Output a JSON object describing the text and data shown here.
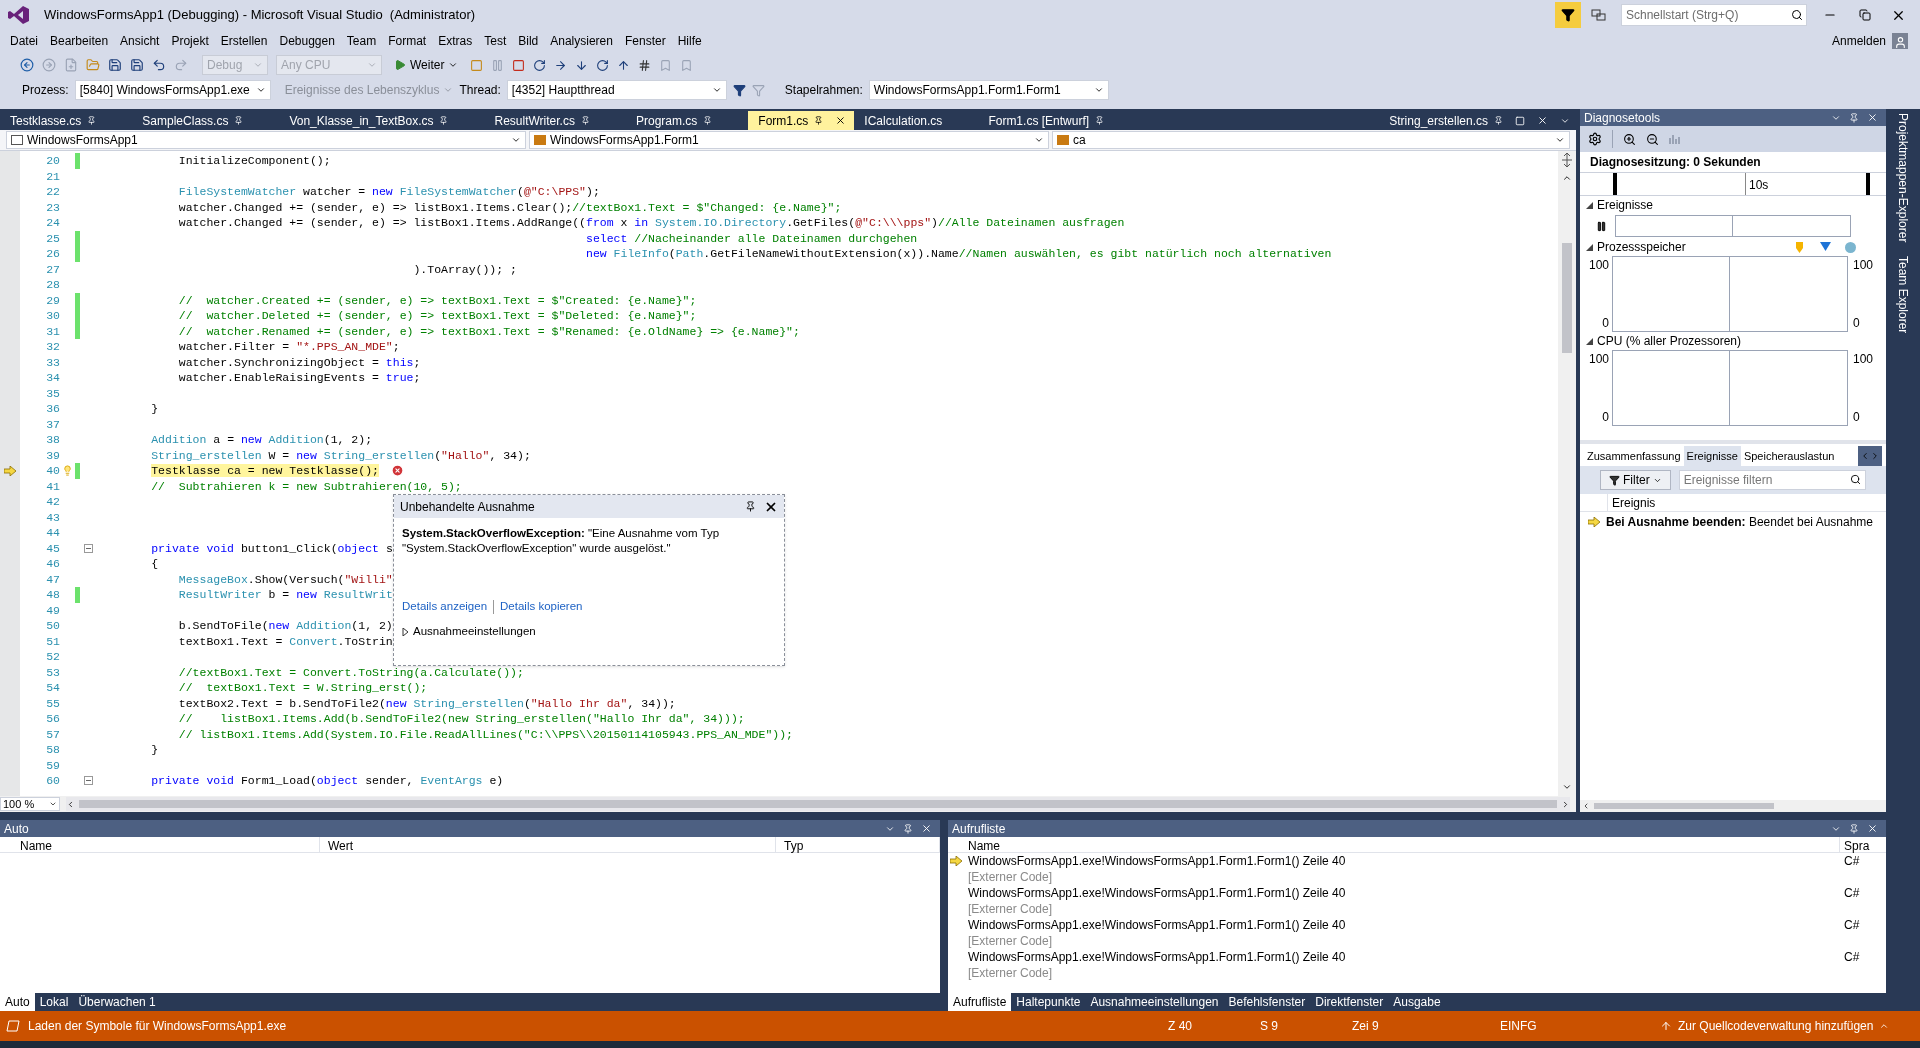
{
  "window": {
    "title": "WindowsFormsApp1 (Debugging) - Microsoft Visual Studio  (Administrator)",
    "quick_launch": {
      "placeholder": "Schnellstart (Strg+Q)"
    }
  },
  "menu": {
    "items": [
      "Datei",
      "Bearbeiten",
      "Ansicht",
      "Projekt",
      "Erstellen",
      "Debuggen",
      "Team",
      "Format",
      "Extras",
      "Test",
      "Bild",
      "Analysieren",
      "Fenster",
      "Hilfe"
    ],
    "account": "Anmelden"
  },
  "toolbar": {
    "configuration": {
      "value": "Debug",
      "disabled": true
    },
    "platform": {
      "value": "Any CPU",
      "disabled": true
    },
    "continue": "Weiter"
  },
  "debug_location": {
    "process_label": "Prozess:",
    "process": "[5840] WindowsFormsApp1.exe",
    "lifecycle_events": {
      "label": "Ereignisse des Lebenszyklus",
      "disabled": true
    },
    "thread_label": "Thread:",
    "thread": "[4352] Hauptthread",
    "stack_frame_label": "Stapelrahmen:",
    "stack_frame": "WindowsFormsApp1.Form1.Form1"
  },
  "editor": {
    "tabs": [
      {
        "label": "Testklasse.cs",
        "selected": false,
        "pinned": true
      },
      {
        "label": "SampleClass.cs",
        "selected": false,
        "pinned": true
      },
      {
        "label": "Von_Klasse_in_TextBox.cs",
        "selected": false,
        "pinned": true
      },
      {
        "label": "ResultWriter.cs",
        "selected": false,
        "pinned": true
      },
      {
        "label": "Program.cs",
        "selected": false,
        "pinned": true
      },
      {
        "label": "Form1.cs",
        "selected": true,
        "pinned": true
      },
      {
        "label": "ICalculation.cs",
        "selected": false,
        "pinned": false
      },
      {
        "label": "Form1.cs [Entwurf]",
        "selected": false,
        "pinned": true
      }
    ],
    "right_tab": {
      "label": "String_erstellen.cs",
      "pinned": true
    },
    "navigation": [
      "WindowsFormsApp1",
      "WindowsFormsApp1.Form1",
      "ca"
    ],
    "lines": [
      {
        "number": "20",
        "changed": true,
        "current": false,
        "foldable": false,
        "code": [
          {
            "kind": "plain",
            "text": "            InitializeComponent();"
          }
        ]
      },
      {
        "number": "21",
        "changed": false,
        "current": false,
        "foldable": false
      },
      {
        "number": "22",
        "changed": false,
        "current": false,
        "foldable": false,
        "code": [
          {
            "kind": "type",
            "text": "            FileSystemWatcher"
          },
          {
            "kind": "plain",
            "text": " watcher = "
          },
          {
            "kind": "kw",
            "text": "new "
          },
          {
            "kind": "type",
            "text": "FileSystemWatcher"
          },
          {
            "kind": "plain",
            "text": "("
          },
          {
            "kind": "str",
            "text": "@\"C:\\PPS\""
          },
          {
            "kind": "plain",
            "text": ");"
          }
        ]
      },
      {
        "number": "23",
        "changed": false,
        "current": false,
        "foldable": false,
        "code": [
          {
            "kind": "plain",
            "text": "            watcher.Changed += (sender, e) => listBox1.Items.Clear();"
          },
          {
            "kind": "comment",
            "text": "//textBox1.Text = $\"Changed: {e.Name}\";"
          }
        ]
      },
      {
        "number": "24",
        "changed": false,
        "current": false,
        "foldable": false,
        "code": [
          {
            "kind": "plain",
            "text": "            watcher.Changed += (sender, e) => listBox1.Items.AddRange(("
          },
          {
            "kind": "kw",
            "text": "from"
          },
          {
            "kind": "plain",
            "text": " x "
          },
          {
            "kind": "kw",
            "text": "in "
          },
          {
            "kind": "type",
            "text": "System.IO.Directory"
          },
          {
            "kind": "plain",
            "text": ".GetFiles("
          },
          {
            "kind": "str",
            "text": "@\"C:\\\\\\pps\""
          },
          {
            "kind": "plain",
            "text": ")"
          },
          {
            "kind": "comment",
            "text": "//Alle Dateinamen ausfragen"
          }
        ]
      },
      {
        "number": "25",
        "changed": true,
        "current": false,
        "foldable": false,
        "code": [
          {
            "kind": "kw",
            "text": "                                                                       select "
          },
          {
            "kind": "comment",
            "text": "//Nacheinander alle Dateinamen durchgehen"
          }
        ]
      },
      {
        "number": "26",
        "changed": true,
        "current": false,
        "foldable": false,
        "code": [
          {
            "kind": "kw",
            "text": "                                                                       new "
          },
          {
            "kind": "type",
            "text": "FileInfo"
          },
          {
            "kind": "plain",
            "text": "("
          },
          {
            "kind": "type",
            "text": "Path"
          },
          {
            "kind": "plain",
            "text": ".GetFileNameWithoutExtension(x)).Name"
          },
          {
            "kind": "comment",
            "text": "//Namen auswählen, es gibt natürlich noch alternativen"
          }
        ]
      },
      {
        "number": "27",
        "changed": false,
        "current": false,
        "foldable": false,
        "code": [
          {
            "kind": "plain",
            "text": "                                              ).ToArray()); ;"
          }
        ]
      },
      {
        "number": "28",
        "changed": false,
        "current": false,
        "foldable": false
      },
      {
        "number": "29",
        "changed": true,
        "current": false,
        "foldable": false,
        "code": [
          {
            "kind": "comment",
            "text": "            //  watcher.Created += (sender, e) => textBox1.Text = $\"Created: {e.Name}\";"
          }
        ]
      },
      {
        "number": "30",
        "changed": true,
        "current": false,
        "foldable": false,
        "code": [
          {
            "kind": "comment",
            "text": "            //  watcher.Deleted += (sender, e) => textBox1.Text = $\"Deleted: {e.Name}\";"
          }
        ]
      },
      {
        "number": "31",
        "changed": true,
        "current": false,
        "foldable": false,
        "code": [
          {
            "kind": "comment",
            "text": "            //  watcher.Renamed += (sender, e) => textBox1.Text = $\"Renamed: {e.OldName} => {e.Name}\";"
          }
        ]
      },
      {
        "number": "32",
        "changed": false,
        "current": false,
        "foldable": false,
        "code": [
          {
            "kind": "plain",
            "text": "            watcher.Filter = "
          },
          {
            "kind": "str",
            "text": "\"*.PPS_AN_MDE\""
          },
          {
            "kind": "plain",
            "text": ";"
          }
        ]
      },
      {
        "number": "33",
        "changed": false,
        "current": false,
        "foldable": false,
        "code": [
          {
            "kind": "plain",
            "text": "            watcher.SynchronizingObject = "
          },
          {
            "kind": "kw",
            "text": "this"
          },
          {
            "kind": "plain",
            "text": ";"
          }
        ]
      },
      {
        "number": "34",
        "changed": false,
        "current": false,
        "foldable": false,
        "code": [
          {
            "kind": "plain",
            "text": "            watcher.EnableRaisingEvents = "
          },
          {
            "kind": "kw",
            "text": "true"
          },
          {
            "kind": "plain",
            "text": ";"
          }
        ]
      },
      {
        "number": "35",
        "changed": false,
        "current": false,
        "foldable": false
      },
      {
        "number": "36",
        "changed": false,
        "current": false,
        "foldable": false,
        "code": [
          {
            "kind": "plain",
            "text": "        }"
          }
        ]
      },
      {
        "number": "37",
        "changed": false,
        "current": false,
        "foldable": false
      },
      {
        "number": "38",
        "changed": false,
        "current": false,
        "foldable": false,
        "code": [
          {
            "kind": "type",
            "text": "        Addition"
          },
          {
            "kind": "plain",
            "text": " a = "
          },
          {
            "kind": "kw",
            "text": "new "
          },
          {
            "kind": "type",
            "text": "Addition"
          },
          {
            "kind": "plain",
            "text": "(1, 2);"
          }
        ]
      },
      {
        "number": "39",
        "changed": false,
        "current": false,
        "foldable": false,
        "code": [
          {
            "kind": "type",
            "text": "        String_erstellen"
          },
          {
            "kind": "plain",
            "text": " W = "
          },
          {
            "kind": "kw",
            "text": "new "
          },
          {
            "kind": "type",
            "text": "String_erstellen"
          },
          {
            "kind": "plain",
            "text": "("
          },
          {
            "kind": "str",
            "text": "\"Hallo\""
          },
          {
            "kind": "plain",
            "text": ", 34);"
          }
        ]
      },
      {
        "number": "40",
        "changed": true,
        "current": true,
        "foldable": false,
        "code": [
          {
            "kind": "statement",
            "text": "        Testklasse ca = new Testklasse();"
          }
        ]
      },
      {
        "number": "41",
        "changed": false,
        "current": false,
        "foldable": false,
        "code": [
          {
            "kind": "comment",
            "text": "        //  Subtrahieren k = new Subtrahieren(10, 5);"
          }
        ]
      },
      {
        "number": "42",
        "changed": false,
        "current": false,
        "foldable": false
      },
      {
        "number": "43",
        "changed": false,
        "current": false,
        "foldable": false
      },
      {
        "number": "44",
        "changed": false,
        "current": false,
        "foldable": false
      },
      {
        "number": "45",
        "changed": false,
        "current": false,
        "foldable": true,
        "code": [
          {
            "kind": "kw",
            "text": "        private void "
          },
          {
            "kind": "plain",
            "text": "button1_Click("
          },
          {
            "kind": "kw",
            "text": "object"
          },
          {
            "kind": "plain",
            "text": " s"
          }
        ]
      },
      {
        "number": "46",
        "changed": false,
        "current": false,
        "foldable": false,
        "code": [
          {
            "kind": "plain",
            "text": "        {"
          }
        ]
      },
      {
        "number": "47",
        "changed": false,
        "current": false,
        "foldable": false,
        "code": [
          {
            "kind": "type",
            "text": "            MessageBox"
          },
          {
            "kind": "plain",
            "text": ".Show(Versuch("
          },
          {
            "kind": "str",
            "text": "\"Willi\""
          }
        ]
      },
      {
        "number": "48",
        "changed": true,
        "current": false,
        "foldable": false,
        "code": [
          {
            "kind": "type",
            "text": "            ResultWriter"
          },
          {
            "kind": "plain",
            "text": " b = "
          },
          {
            "kind": "kw",
            "text": "new "
          },
          {
            "kind": "type",
            "text": "ResultWrit"
          }
        ]
      },
      {
        "number": "49",
        "changed": false,
        "current": false,
        "foldable": false
      },
      {
        "number": "50",
        "changed": false,
        "current": false,
        "foldable": false,
        "code": [
          {
            "kind": "plain",
            "text": "            b.SendToFile("
          },
          {
            "kind": "kw",
            "text": "new "
          },
          {
            "kind": "type",
            "text": "Addition"
          },
          {
            "kind": "plain",
            "text": "(1, 2)"
          }
        ]
      },
      {
        "number": "51",
        "changed": false,
        "current": false,
        "foldable": false,
        "code": [
          {
            "kind": "plain",
            "text": "            textBox1.Text = "
          },
          {
            "kind": "type",
            "text": "Convert"
          },
          {
            "kind": "plain",
            "text": ".ToStrin"
          }
        ]
      },
      {
        "number": "52",
        "changed": false,
        "current": false,
        "foldable": false
      },
      {
        "number": "53",
        "changed": false,
        "current": false,
        "foldable": false,
        "code": [
          {
            "kind": "comment",
            "text": "            //textBox1.Text = Convert.ToString(a.Calculate());"
          }
        ]
      },
      {
        "number": "54",
        "changed": false,
        "current": false,
        "foldable": false,
        "code": [
          {
            "kind": "comment",
            "text": "            //  textBox1.Text = W.String_erst();"
          }
        ]
      },
      {
        "number": "55",
        "changed": false,
        "current": false,
        "foldable": false,
        "code": [
          {
            "kind": "plain",
            "text": "            textBox2.Text = b.SendToFile2("
          },
          {
            "kind": "kw",
            "text": "new "
          },
          {
            "kind": "type",
            "text": "String_erstellen"
          },
          {
            "kind": "plain",
            "text": "("
          },
          {
            "kind": "str",
            "text": "\"Hallo Ihr da\""
          },
          {
            "kind": "plain",
            "text": ", 34));"
          }
        ]
      },
      {
        "number": "56",
        "changed": false,
        "current": false,
        "foldable": false,
        "code": [
          {
            "kind": "comment",
            "text": "            //    listBox1.Items.Add(b.SendToFile2(new String_erstellen(\"Hallo Ihr da\", 34)));"
          }
        ]
      },
      {
        "number": "57",
        "changed": false,
        "current": false,
        "foldable": false,
        "code": [
          {
            "kind": "comment",
            "text": "            // listBox1.Items.Add(System.IO.File.ReadAllLines(\"C:\\\\PPS\\\\20150114105943.PPS_AN_MDE\"));"
          }
        ]
      },
      {
        "number": "58",
        "changed": false,
        "current": false,
        "foldable": false,
        "code": [
          {
            "kind": "plain",
            "text": "        }"
          }
        ]
      },
      {
        "number": "59",
        "changed": false,
        "current": false,
        "foldable": false
      },
      {
        "number": "60",
        "changed": false,
        "current": false,
        "foldable": true,
        "code": [
          {
            "kind": "kw",
            "text": "        private void "
          },
          {
            "kind": "plain",
            "text": "Form1_Load("
          },
          {
            "kind": "kw",
            "text": "object"
          },
          {
            "kind": "plain",
            "text": " sender, "
          },
          {
            "kind": "type",
            "text": "EventArgs"
          },
          {
            "kind": "plain",
            "text": " e)"
          }
        ]
      }
    ],
    "exception": {
      "title": "Unbehandelte Ausnahme",
      "message": "**System.StackOverflowException:** \"Eine Ausnahme vom Typ \"System.StackOverflowException\" wurde ausgelöst.\"",
      "links": [
        "Details anzeigen",
        "Details kopieren"
      ],
      "settings": {
        "label": "Ausnahmeeinstellungen",
        "expanded": false
      }
    },
    "zoom": "100 %"
  },
  "diagnostics": {
    "title": "Diagnosetools",
    "session": "Diagnosesitzung: 0 Sekunden",
    "ruler_label": "10s",
    "sections": [
      {
        "kind": "events",
        "title": "Ereignisse",
        "expanded": true
      },
      {
        "kind": "chart",
        "title": "Prozessspeicher",
        "expanded": true,
        "legend": true,
        "left_axis": [
          "100",
          "0"
        ],
        "right_axis": [
          "100",
          "0"
        ]
      },
      {
        "kind": "chart",
        "title": "CPU (% aller Prozessoren)",
        "expanded": true,
        "legend": false,
        "left_axis": [
          "100",
          "0"
        ],
        "right_axis": [
          "100",
          "0"
        ]
      }
    ],
    "tabs": [
      {
        "label": "Zusammenfassung",
        "selected": false
      },
      {
        "label": "Ereignisse",
        "selected": true
      },
      {
        "label": "Speicherauslastun",
        "selected": false
      }
    ],
    "filter": "Filter",
    "search": {
      "placeholder": "Ereignisse filtern"
    },
    "column": "Ereignis",
    "events": [
      "**Bei Ausnahme beenden:** Beendet bei Ausnahme"
    ]
  },
  "side_tabs": [
    "Projektmappen-Explorer",
    "Team Explorer"
  ],
  "autos": {
    "title": "Auto",
    "columns": [
      "Name",
      "Wert",
      "Typ"
    ],
    "tabs": [
      {
        "label": "Auto",
        "selected": true
      },
      {
        "label": "Lokal",
        "selected": false
      },
      {
        "label": "Überwachen 1",
        "selected": false
      }
    ]
  },
  "call_stack": {
    "title": "Aufrufliste",
    "columns": [
      "Name",
      "Spra"
    ],
    "rows": [
      {
        "kind": "frame",
        "name": "WindowsFormsApp1.exe!WindowsFormsApp1.Form1.Form1() Zeile 40",
        "language": "C#",
        "current": true
      },
      {
        "kind": "external",
        "name": "[Externer Code]",
        "current": false
      },
      {
        "kind": "frame",
        "name": "WindowsFormsApp1.exe!WindowsFormsApp1.Form1.Form1() Zeile 40",
        "language": "C#",
        "current": false
      },
      {
        "kind": "external",
        "name": "[Externer Code]",
        "current": false
      },
      {
        "kind": "frame",
        "name": "WindowsFormsApp1.exe!WindowsFormsApp1.Form1.Form1() Zeile 40",
        "language": "C#",
        "current": false
      },
      {
        "kind": "external",
        "name": "[Externer Code]",
        "current": false
      },
      {
        "kind": "frame",
        "name": "WindowsFormsApp1.exe!WindowsFormsApp1.Form1.Form1() Zeile 40",
        "language": "C#",
        "current": false
      },
      {
        "kind": "external",
        "name": "[Externer Code]",
        "current": false
      }
    ],
    "tabs": [
      {
        "label": "Aufrufliste",
        "selected": true
      },
      {
        "label": "Haltepunkte",
        "selected": false
      },
      {
        "label": "Ausnahmeeinstellungen",
        "selected": false
      },
      {
        "label": "Befehlsfenster",
        "selected": false
      },
      {
        "label": "Direktfenster",
        "selected": false
      },
      {
        "label": "Ausgabe",
        "selected": false
      }
    ]
  },
  "status_bar": {
    "message": "Laden der Symbole für WindowsFormsApp1.exe",
    "line": "Z 40",
    "column": "S 9",
    "char": "Zei 9",
    "mode": "EINFG",
    "source_control": "Zur Quellcodeverwaltung hinzufügen"
  }
}
